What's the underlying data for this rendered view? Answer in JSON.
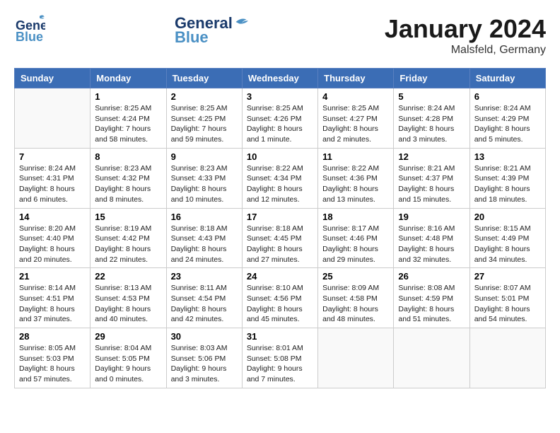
{
  "header": {
    "logo_line1": "General",
    "logo_line2": "Blue",
    "month": "January 2024",
    "location": "Malsfeld, Germany"
  },
  "weekdays": [
    "Sunday",
    "Monday",
    "Tuesday",
    "Wednesday",
    "Thursday",
    "Friday",
    "Saturday"
  ],
  "weeks": [
    [
      {
        "day": "",
        "detail": ""
      },
      {
        "day": "1",
        "detail": "Sunrise: 8:25 AM\nSunset: 4:24 PM\nDaylight: 7 hours\nand 58 minutes."
      },
      {
        "day": "2",
        "detail": "Sunrise: 8:25 AM\nSunset: 4:25 PM\nDaylight: 7 hours\nand 59 minutes."
      },
      {
        "day": "3",
        "detail": "Sunrise: 8:25 AM\nSunset: 4:26 PM\nDaylight: 8 hours\nand 1 minute."
      },
      {
        "day": "4",
        "detail": "Sunrise: 8:25 AM\nSunset: 4:27 PM\nDaylight: 8 hours\nand 2 minutes."
      },
      {
        "day": "5",
        "detail": "Sunrise: 8:24 AM\nSunset: 4:28 PM\nDaylight: 8 hours\nand 3 minutes."
      },
      {
        "day": "6",
        "detail": "Sunrise: 8:24 AM\nSunset: 4:29 PM\nDaylight: 8 hours\nand 5 minutes."
      }
    ],
    [
      {
        "day": "7",
        "detail": "Sunrise: 8:24 AM\nSunset: 4:31 PM\nDaylight: 8 hours\nand 6 minutes."
      },
      {
        "day": "8",
        "detail": "Sunrise: 8:23 AM\nSunset: 4:32 PM\nDaylight: 8 hours\nand 8 minutes."
      },
      {
        "day": "9",
        "detail": "Sunrise: 8:23 AM\nSunset: 4:33 PM\nDaylight: 8 hours\nand 10 minutes."
      },
      {
        "day": "10",
        "detail": "Sunrise: 8:22 AM\nSunset: 4:34 PM\nDaylight: 8 hours\nand 12 minutes."
      },
      {
        "day": "11",
        "detail": "Sunrise: 8:22 AM\nSunset: 4:36 PM\nDaylight: 8 hours\nand 13 minutes."
      },
      {
        "day": "12",
        "detail": "Sunrise: 8:21 AM\nSunset: 4:37 PM\nDaylight: 8 hours\nand 15 minutes."
      },
      {
        "day": "13",
        "detail": "Sunrise: 8:21 AM\nSunset: 4:39 PM\nDaylight: 8 hours\nand 18 minutes."
      }
    ],
    [
      {
        "day": "14",
        "detail": "Sunrise: 8:20 AM\nSunset: 4:40 PM\nDaylight: 8 hours\nand 20 minutes."
      },
      {
        "day": "15",
        "detail": "Sunrise: 8:19 AM\nSunset: 4:42 PM\nDaylight: 8 hours\nand 22 minutes."
      },
      {
        "day": "16",
        "detail": "Sunrise: 8:18 AM\nSunset: 4:43 PM\nDaylight: 8 hours\nand 24 minutes."
      },
      {
        "day": "17",
        "detail": "Sunrise: 8:18 AM\nSunset: 4:45 PM\nDaylight: 8 hours\nand 27 minutes."
      },
      {
        "day": "18",
        "detail": "Sunrise: 8:17 AM\nSunset: 4:46 PM\nDaylight: 8 hours\nand 29 minutes."
      },
      {
        "day": "19",
        "detail": "Sunrise: 8:16 AM\nSunset: 4:48 PM\nDaylight: 8 hours\nand 32 minutes."
      },
      {
        "day": "20",
        "detail": "Sunrise: 8:15 AM\nSunset: 4:49 PM\nDaylight: 8 hours\nand 34 minutes."
      }
    ],
    [
      {
        "day": "21",
        "detail": "Sunrise: 8:14 AM\nSunset: 4:51 PM\nDaylight: 8 hours\nand 37 minutes."
      },
      {
        "day": "22",
        "detail": "Sunrise: 8:13 AM\nSunset: 4:53 PM\nDaylight: 8 hours\nand 40 minutes."
      },
      {
        "day": "23",
        "detail": "Sunrise: 8:11 AM\nSunset: 4:54 PM\nDaylight: 8 hours\nand 42 minutes."
      },
      {
        "day": "24",
        "detail": "Sunrise: 8:10 AM\nSunset: 4:56 PM\nDaylight: 8 hours\nand 45 minutes."
      },
      {
        "day": "25",
        "detail": "Sunrise: 8:09 AM\nSunset: 4:58 PM\nDaylight: 8 hours\nand 48 minutes."
      },
      {
        "day": "26",
        "detail": "Sunrise: 8:08 AM\nSunset: 4:59 PM\nDaylight: 8 hours\nand 51 minutes."
      },
      {
        "day": "27",
        "detail": "Sunrise: 8:07 AM\nSunset: 5:01 PM\nDaylight: 8 hours\nand 54 minutes."
      }
    ],
    [
      {
        "day": "28",
        "detail": "Sunrise: 8:05 AM\nSunset: 5:03 PM\nDaylight: 8 hours\nand 57 minutes."
      },
      {
        "day": "29",
        "detail": "Sunrise: 8:04 AM\nSunset: 5:05 PM\nDaylight: 9 hours\nand 0 minutes."
      },
      {
        "day": "30",
        "detail": "Sunrise: 8:03 AM\nSunset: 5:06 PM\nDaylight: 9 hours\nand 3 minutes."
      },
      {
        "day": "31",
        "detail": "Sunrise: 8:01 AM\nSunset: 5:08 PM\nDaylight: 9 hours\nand 7 minutes."
      },
      {
        "day": "",
        "detail": ""
      },
      {
        "day": "",
        "detail": ""
      },
      {
        "day": "",
        "detail": ""
      }
    ]
  ]
}
